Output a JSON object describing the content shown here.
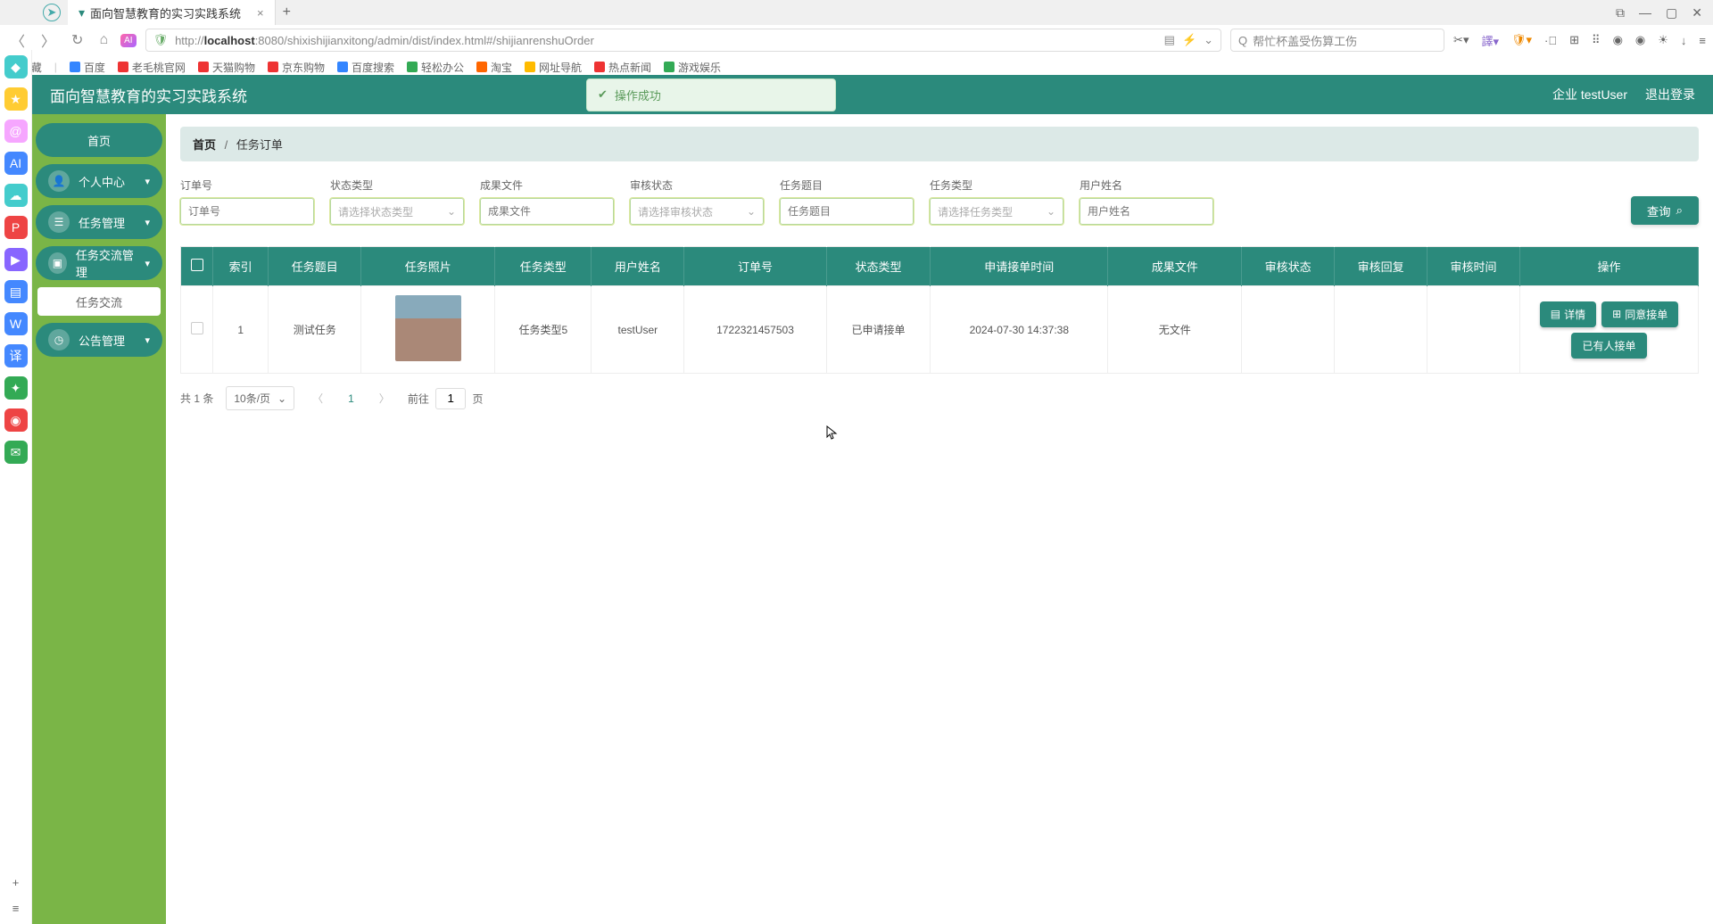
{
  "browser": {
    "tab_title": "面向智慧教育的实习实践系统",
    "url_prefix": "http://",
    "url_host": "localhost",
    "url_rest": ":8080/shixishijianxitong/admin/dist/index.html#/shijianrenshuOrder",
    "search_placeholder": "帮忙杯盖受伤算工伤",
    "bookmarks": [
      "收藏",
      "百度",
      "老毛桃官网",
      "天猫购物",
      "京东购物",
      "百度搜索",
      "轻松办公",
      "淘宝",
      "网址导航",
      "热点新闻",
      "游戏娱乐"
    ]
  },
  "app": {
    "title": "面向智慧教育的实习实践系统",
    "toast": "操作成功",
    "user_label": "企业 testUser",
    "logout": "退出登录"
  },
  "nav": {
    "home": "首页",
    "profile": "个人中心",
    "task_mgmt": "任务管理",
    "task_comm_mgmt": "任务交流管理",
    "task_comm": "任务交流",
    "notice_mgmt": "公告管理"
  },
  "breadcrumb": {
    "home": "首页",
    "current": "任务订单"
  },
  "filters": {
    "labels": [
      "订单号",
      "状态类型",
      "成果文件",
      "审核状态",
      "任务题目",
      "任务类型",
      "用户姓名"
    ],
    "placeholders": [
      "订单号",
      "请选择状态类型",
      "成果文件",
      "请选择审核状态",
      "任务题目",
      "请选择任务类型",
      "用户姓名"
    ],
    "query_btn": "查询"
  },
  "table": {
    "headers": [
      "",
      "索引",
      "任务题目",
      "任务照片",
      "任务类型",
      "用户姓名",
      "订单号",
      "状态类型",
      "申请接单时间",
      "成果文件",
      "审核状态",
      "审核回复",
      "审核时间",
      "操作"
    ],
    "row": {
      "index": "1",
      "task_title": "测试任务",
      "task_type": "任务类型5",
      "user_name": "testUser",
      "order_no": "1722321457503",
      "status_type": "已申请接单",
      "apply_time": "2024-07-30 14:37:38",
      "result_file": "无文件",
      "audit_status": "",
      "audit_reply": "",
      "audit_time": ""
    },
    "ops": {
      "detail": "详情",
      "agree": "同意接单",
      "taken": "已有人接单"
    }
  },
  "pager": {
    "total": "共 1 条",
    "page_size": "10条/页",
    "current": "1",
    "goto_prefix": "前往",
    "goto_value": "1",
    "goto_suffix": "页"
  }
}
